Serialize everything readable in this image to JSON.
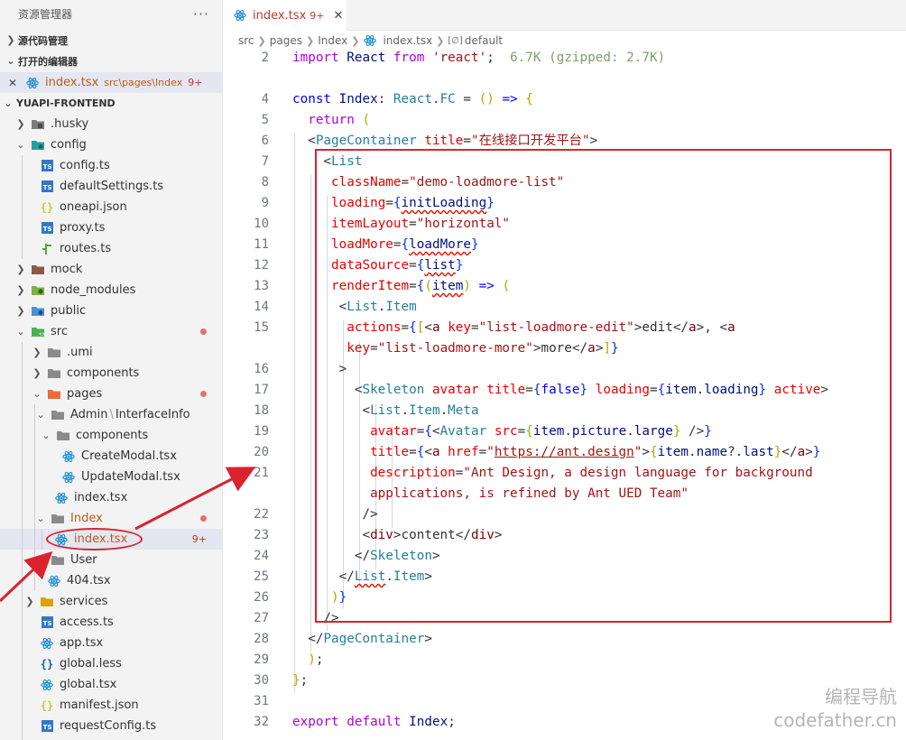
{
  "explorer": {
    "title": "资源管理器",
    "more": "···",
    "source_control": "源代码管理",
    "open_editors": "打开的编辑器",
    "open_editor_item": {
      "name": "index.tsx",
      "path": "src\\pages\\Index",
      "badge": "9+"
    },
    "project": "YUAPI-FRONTEND"
  },
  "tree": [
    {
      "label": ".husky"
    },
    {
      "label": "config"
    },
    {
      "label": "config.ts"
    },
    {
      "label": "defaultSettings.ts"
    },
    {
      "label": "oneapi.json"
    },
    {
      "label": "proxy.ts"
    },
    {
      "label": "routes.ts"
    },
    {
      "label": "mock"
    },
    {
      "label": "node_modules"
    },
    {
      "label": "public"
    },
    {
      "label": "src"
    },
    {
      "label": ".umi"
    },
    {
      "label": "components"
    },
    {
      "label": "pages"
    },
    {
      "label": "Admin",
      "label2": "InterfaceInfo"
    },
    {
      "label": "components"
    },
    {
      "label": "CreateModal.tsx"
    },
    {
      "label": "UpdateModal.tsx"
    },
    {
      "label": "index.tsx"
    },
    {
      "label": "Index"
    },
    {
      "label": "index.tsx",
      "badge": "9+"
    },
    {
      "label": "User"
    },
    {
      "label": "404.tsx"
    },
    {
      "label": "services"
    },
    {
      "label": "access.ts"
    },
    {
      "label": "app.tsx"
    },
    {
      "label": "global.less"
    },
    {
      "label": "global.tsx"
    },
    {
      "label": "manifest.json"
    },
    {
      "label": "requestConfig.ts"
    }
  ],
  "tab": {
    "name": "index.tsx",
    "badge": "9+",
    "close": "✕"
  },
  "breadcrumb": [
    "src",
    "pages",
    "Index",
    "index.tsx",
    "default"
  ],
  "code": {
    "line_numbers": [
      "2",
      "",
      "4",
      "5",
      "6",
      "7",
      "8",
      "9",
      "10",
      "11",
      "12",
      "13",
      "14",
      "15",
      "",
      "16",
      "17",
      "18",
      "19",
      "20",
      "21",
      "",
      "22",
      "23",
      "24",
      "25",
      "26",
      "27",
      "28",
      "29",
      "30",
      "31",
      "32"
    ],
    "import_size": "6.7K (gzipped: 2.7K)",
    "page_title": "\"在线接口开发平台\"",
    "class_name": "\"demo-loadmore-list\"",
    "item_layout": "\"horizontal\"",
    "edit_key": "\"list-loadmore-edit\"",
    "more_key": "\"list-loadmore-more\"",
    "href": "https://ant.design",
    "description_1": "\"Ant Design, a design language for background",
    "description_2": "applications, is refined by Ant UED Team\""
  },
  "watermark": {
    "line1": "编程导航",
    "line2": "codefather.cn"
  },
  "colors": {
    "annotation_red": "#d9232e",
    "ts_blue": "#3178c6",
    "react_blue": "#1f8fd1"
  }
}
